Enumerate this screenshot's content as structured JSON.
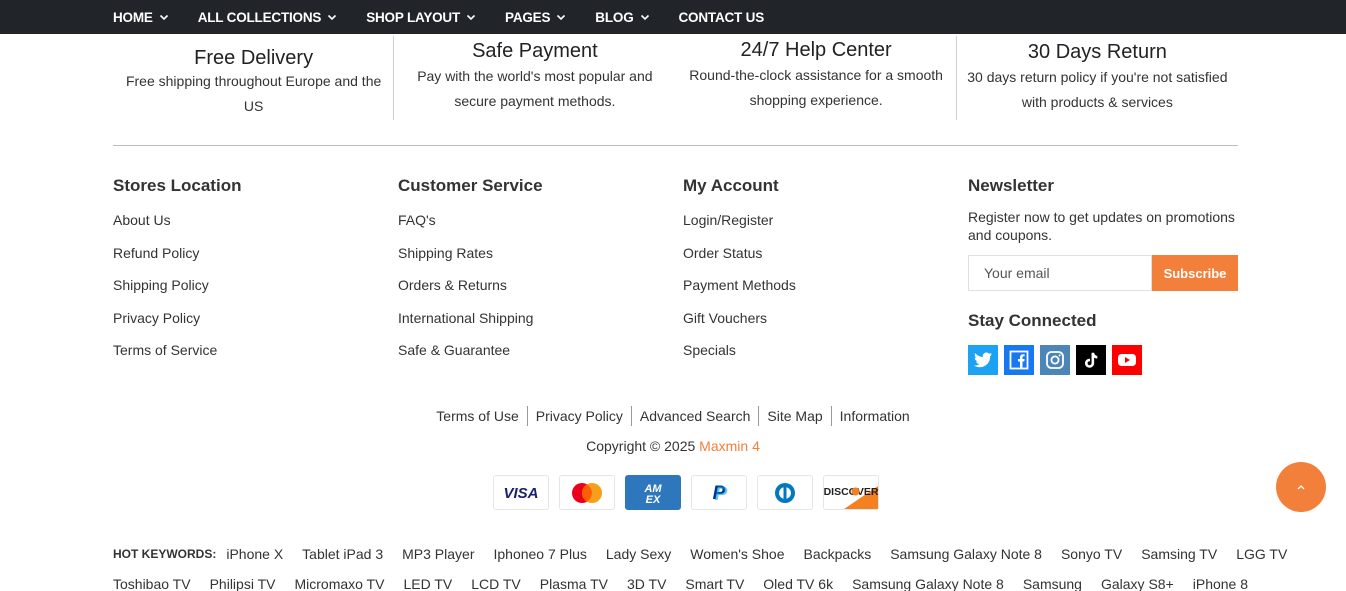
{
  "nav": {
    "items": [
      {
        "label": "HOME",
        "dropdown": true
      },
      {
        "label": "ALL COLLECTIONS",
        "dropdown": true
      },
      {
        "label": "SHOP LAYOUT",
        "dropdown": true
      },
      {
        "label": "PAGES",
        "dropdown": true
      },
      {
        "label": "BLOG",
        "dropdown": true
      },
      {
        "label": "CONTACT US",
        "dropdown": false
      }
    ]
  },
  "features": [
    {
      "title": "Free Delivery",
      "desc": "Free shipping throughout Europe and the US"
    },
    {
      "title": "Safe Payment",
      "desc": "Pay with the world's most popular and secure payment methods."
    },
    {
      "title": "24/7 Help Center",
      "desc": "Round-the-clock assistance for a smooth shopping experience."
    },
    {
      "title": "30 Days Return",
      "desc": "30 days return policy if you're not satisfied with products & services"
    }
  ],
  "footer": {
    "stores": {
      "title": "Stores Location",
      "links": [
        "About Us",
        "Refund Policy",
        "Shipping Policy",
        "Privacy Policy",
        "Terms of Service"
      ]
    },
    "service": {
      "title": "Customer Service",
      "links": [
        "FAQ's",
        "Shipping Rates",
        "Orders & Returns",
        "International Shipping",
        "Safe & Guarantee"
      ]
    },
    "account": {
      "title": "My Account",
      "links": [
        "Login/Register",
        "Order Status",
        "Payment Methods",
        "Gift Vouchers",
        "Specials"
      ]
    },
    "newsletter": {
      "title": "Newsletter",
      "text": "Register now to get updates on promotions and coupons.",
      "placeholder": "Your email",
      "button": "Subscribe",
      "stay_title": "Stay Connected",
      "socials": [
        {
          "icon": "twitter-icon",
          "color": "#1da1f2"
        },
        {
          "icon": "facebook-icon",
          "color": "#1877f2"
        },
        {
          "icon": "instagram-icon",
          "color": "#4c86b8"
        },
        {
          "icon": "tiktok-icon",
          "color": "#000000"
        },
        {
          "icon": "youtube-icon",
          "color": "#ff0000"
        }
      ]
    }
  },
  "bottom_links": [
    "Terms of Use",
    "Privacy Policy",
    "Advanced Search",
    "Site Map",
    "Information"
  ],
  "copyright": {
    "prefix": "Copyright © 2025 ",
    "brand": "Maxmin 4"
  },
  "payments": [
    {
      "icon": "visa-icon",
      "label": "VISA"
    },
    {
      "icon": "mastercard-icon",
      "label": ""
    },
    {
      "icon": "amex-icon",
      "label": "AM EX"
    },
    {
      "icon": "paypal-icon",
      "label": "P"
    },
    {
      "icon": "diners-icon",
      "label": ""
    },
    {
      "icon": "discover-icon",
      "label": "DISCOVER"
    }
  ],
  "hot_keywords": {
    "label": "HOT KEYWORDS:",
    "row1": [
      "iPhone X",
      "Tablet iPad 3",
      "MP3 Player",
      "Iphoneo 7 Plus",
      "Lady Sexy",
      "Women's Shoe",
      "Backpacks",
      "Samsung Galaxy Note 8",
      "Sonyo TV",
      "Samsing TV",
      "LGG TV"
    ],
    "row2": [
      "Toshibao TV",
      "Philipsi TV",
      "Micromaxo TV",
      "LED TV",
      "LCD TV",
      "Plasma TV",
      "3D TV",
      "Smart TV",
      "Oled TV 6k",
      "Samsung Galaxy Note 8",
      "Samsung",
      "Galaxy S8+",
      "iPhone 8"
    ]
  },
  "colors": {
    "accent": "#f3803a",
    "nav_bg": "#212529"
  }
}
